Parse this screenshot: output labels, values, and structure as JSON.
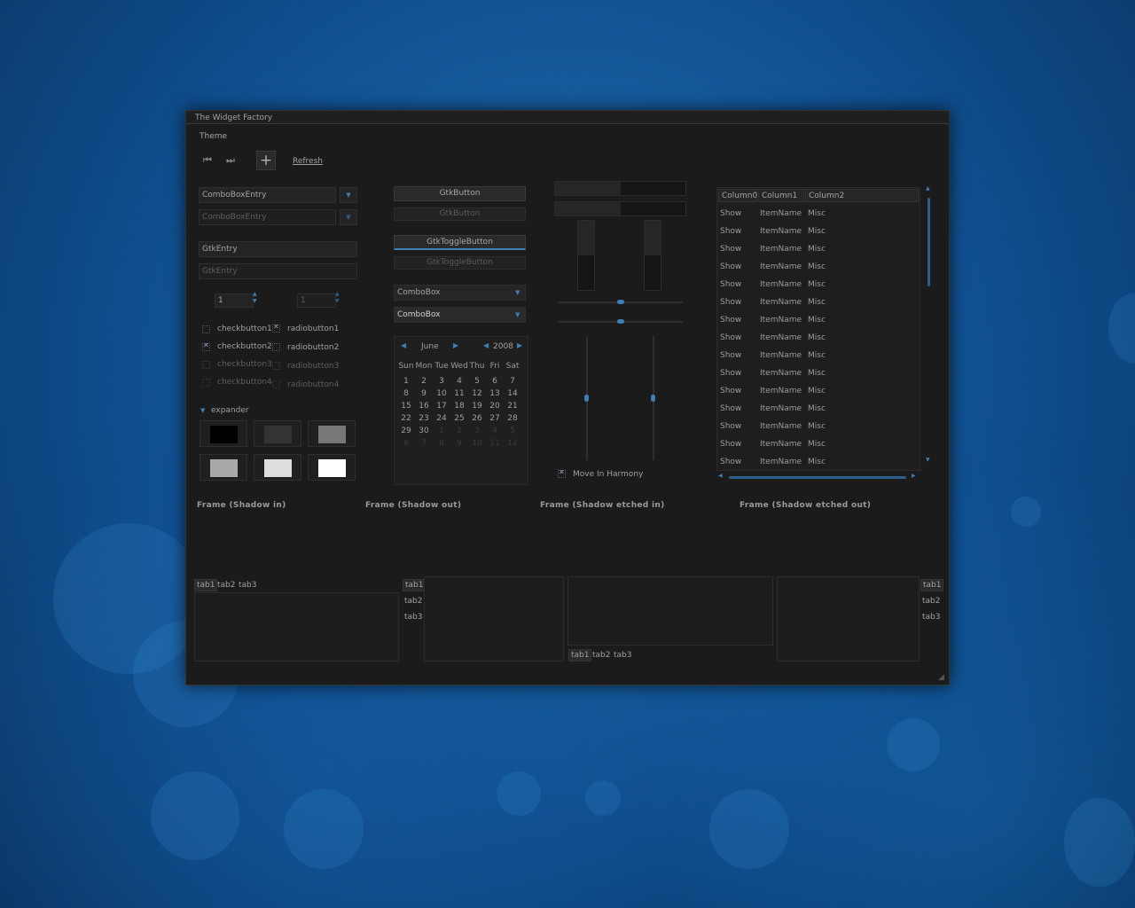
{
  "window": {
    "title": "The Widget Factory"
  },
  "menu": {
    "theme": "Theme"
  },
  "toolbar": {
    "refresh_label": "Refresh",
    "first_icon": "go-first-icon",
    "last_icon": "go-last-icon",
    "add_icon": "add-icon"
  },
  "left": {
    "combo_entry_1": "ComboBoxEntry",
    "combo_entry_2": "ComboBoxEntry",
    "entry_1": "GtkEntry",
    "entry_2": "GtkEntry",
    "spin_1": "1",
    "spin_2": "1",
    "checks": [
      {
        "label": "checkbutton1",
        "checked": false
      },
      {
        "label": "checkbutton2",
        "checked": true
      },
      {
        "label": "checkbutton3",
        "checked": false
      },
      {
        "label": "checkbutton4",
        "checked": false
      }
    ],
    "radios": [
      {
        "label": "radiobutton1",
        "checked": true
      },
      {
        "label": "radiobutton2",
        "checked": false
      },
      {
        "label": "radiobutton3",
        "checked": false
      },
      {
        "label": "radiobutton4",
        "checked": false
      }
    ],
    "expander": "expander",
    "swatches": [
      "#000000",
      "#333333",
      "#777777",
      "#a9a9a9",
      "#dddddd",
      "#ffffff"
    ]
  },
  "middle": {
    "button_1": "GtkButton",
    "button_2": "GtkButton",
    "toggle_1": "GtkToggleButton",
    "toggle_2": "GtkToggleButton",
    "combo_1": "ComboBox",
    "combo_2": "ComboBox",
    "calendar": {
      "month": "June",
      "year": "2008",
      "day_names": [
        "Sun",
        "Mon",
        "Tue",
        "Wed",
        "Thu",
        "Fri",
        "Sat"
      ],
      "weeks": [
        [
          "1",
          "2",
          "3",
          "4",
          "5",
          "6",
          "7"
        ],
        [
          "8",
          "9",
          "10",
          "11",
          "12",
          "13",
          "14"
        ],
        [
          "15",
          "16",
          "17",
          "18",
          "19",
          "20",
          "21"
        ],
        [
          "22",
          "23",
          "24",
          "25",
          "26",
          "27",
          "28"
        ],
        [
          "29",
          "30",
          "1",
          "2",
          "3",
          "4",
          "5"
        ],
        [
          "6",
          "7",
          "8",
          "9",
          "10",
          "11",
          "12"
        ]
      ]
    }
  },
  "sliders": {
    "progress_h1": 0.5,
    "progress_h2": 0.5,
    "progress_v1": 0.5,
    "progress_v2": 0.5,
    "scale_h1": 0.5,
    "scale_h2": 0.5,
    "scale_v1": 0.5,
    "scale_v2": 0.5,
    "harmony_label": "Move In Harmony",
    "harmony_checked": true
  },
  "tree": {
    "columns": [
      "Column0",
      "Column1",
      "Column2"
    ],
    "rows": [
      [
        "Show",
        "ItemName",
        "Misc"
      ],
      [
        "Show",
        "ItemName",
        "Misc"
      ],
      [
        "Show",
        "ItemName",
        "Misc"
      ],
      [
        "Show",
        "ItemName",
        "Misc"
      ],
      [
        "Show",
        "ItemName",
        "Misc"
      ],
      [
        "Show",
        "ItemName",
        "Misc"
      ],
      [
        "Show",
        "ItemName",
        "Misc"
      ],
      [
        "Show",
        "ItemName",
        "Misc"
      ],
      [
        "Show",
        "ItemName",
        "Misc"
      ],
      [
        "Show",
        "ItemName",
        "Misc"
      ],
      [
        "Show",
        "ItemName",
        "Misc"
      ],
      [
        "Show",
        "ItemName",
        "Misc"
      ],
      [
        "Show",
        "ItemName",
        "Misc"
      ],
      [
        "Show",
        "ItemName",
        "Misc"
      ],
      [
        "Show",
        "ItemName",
        "Misc"
      ]
    ]
  },
  "frames": [
    "Frame (Shadow in)",
    "Frame (Shadow out)",
    "Frame (Shadow etched in)",
    "Frame (Shadow etched out)"
  ],
  "notebooks": {
    "tabs": [
      "tab1",
      "tab2",
      "tab3"
    ]
  },
  "colors": {
    "accent": "#3e7fb6",
    "window_bg": "#1b1b1b"
  }
}
